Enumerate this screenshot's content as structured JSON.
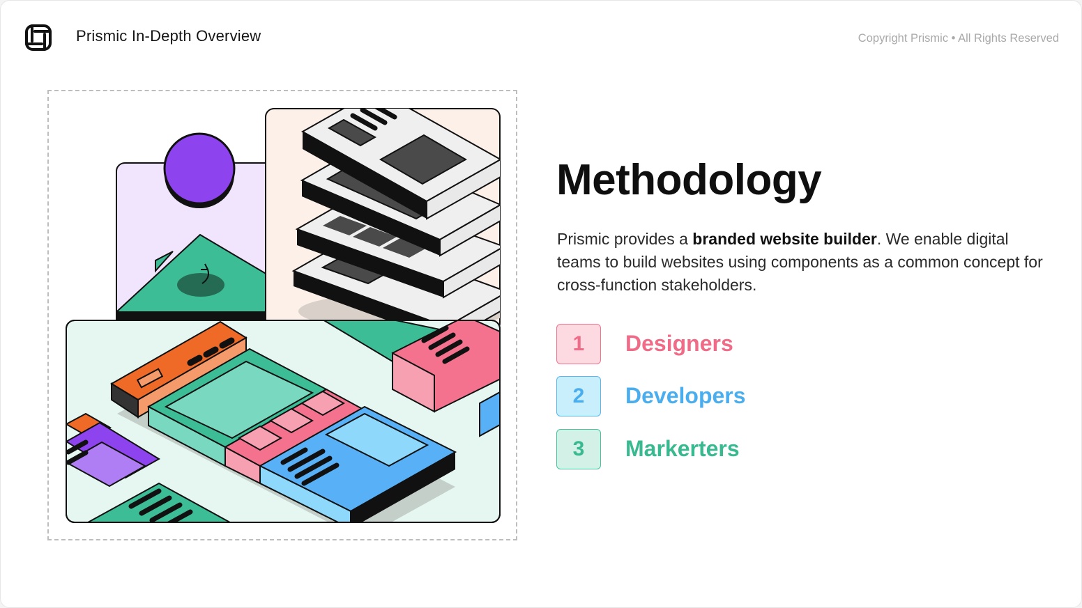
{
  "header": {
    "deck_title": "Prismic In-Depth Overview",
    "copyright": "Copyright Prismic • All Rights Reserved",
    "logo_icon": "prismic-logo-icon"
  },
  "main": {
    "headline": "Methodology",
    "description_before": "Prismic provides a ",
    "description_bold": "branded website builder",
    "description_after": ". We enable digital teams to build websites using components as a common concept for cross-function stakeholders.",
    "roles": [
      {
        "number": "1",
        "label": "Designers",
        "color": "#ef6b87"
      },
      {
        "number": "2",
        "label": "Developers",
        "color": "#4aaeee"
      },
      {
        "number": "3",
        "label": "Markerters",
        "color": "#38b98f"
      }
    ]
  },
  "illustration": {
    "icon": "isometric-website-components-illustration"
  },
  "colors": {
    "purple": "#8d43ee",
    "green": "#3dbd96",
    "pink": "#f4728d",
    "blue": "#58b1f7",
    "orange": "#f06a27"
  }
}
